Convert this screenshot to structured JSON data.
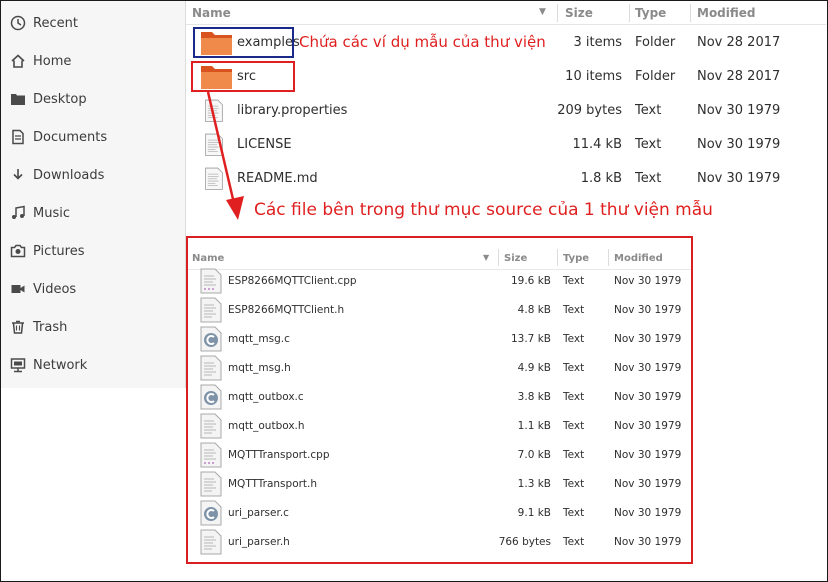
{
  "sidebar": {
    "items": [
      {
        "label": "Recent",
        "icon": "clock-icon"
      },
      {
        "label": "Home",
        "icon": "home-icon"
      },
      {
        "label": "Desktop",
        "icon": "desktop-folder-icon"
      },
      {
        "label": "Documents",
        "icon": "document-icon"
      },
      {
        "label": "Downloads",
        "icon": "download-icon"
      },
      {
        "label": "Music",
        "icon": "music-icon"
      },
      {
        "label": "Pictures",
        "icon": "camera-icon"
      },
      {
        "label": "Videos",
        "icon": "video-icon"
      },
      {
        "label": "Trash",
        "icon": "trash-icon"
      },
      {
        "label": "Network",
        "icon": "network-icon"
      }
    ]
  },
  "list": {
    "headers": {
      "name": "Name",
      "size": "Size",
      "type": "Type",
      "modified": "Modified"
    },
    "rows": [
      {
        "name": "examples",
        "size": "3 items",
        "type": "Folder",
        "modified": "Nov 28 2017",
        "icon": "folder-icon"
      },
      {
        "name": "src",
        "size": "10 items",
        "type": "Folder",
        "modified": "Nov 28 2017",
        "icon": "folder-icon"
      },
      {
        "name": "library.properties",
        "size": "209 bytes",
        "type": "Text",
        "modified": "Nov 30 1979",
        "icon": "text-file-icon"
      },
      {
        "name": "LICENSE",
        "size": "11.4 kB",
        "type": "Text",
        "modified": "Nov 30 1979",
        "icon": "text-file-icon"
      },
      {
        "name": "README.md",
        "size": "1.8 kB",
        "type": "Text",
        "modified": "Nov 30 1979",
        "icon": "text-file-icon"
      }
    ]
  },
  "annotations": {
    "examples_note": "Chứa các ví dụ mẫu của thư viện",
    "src_note": "Các file bên trong thư mục source của 1 thư viện mẫu"
  },
  "src_panel": {
    "headers": {
      "name": "Name",
      "size": "Size",
      "type": "Type",
      "modified": "Modified"
    },
    "rows": [
      {
        "name": "ESP8266MQTTClient.cpp",
        "size": "19.6 kB",
        "type": "Text",
        "modified": "Nov 30 1979",
        "icon": "cpp-file-icon"
      },
      {
        "name": "ESP8266MQTTClient.h",
        "size": "4.8 kB",
        "type": "Text",
        "modified": "Nov 30 1979",
        "icon": "header-file-icon"
      },
      {
        "name": "mqtt_msg.c",
        "size": "13.7 kB",
        "type": "Text",
        "modified": "Nov 30 1979",
        "icon": "c-file-icon"
      },
      {
        "name": "mqtt_msg.h",
        "size": "4.9 kB",
        "type": "Text",
        "modified": "Nov 30 1979",
        "icon": "header-file-icon"
      },
      {
        "name": "mqtt_outbox.c",
        "size": "3.8 kB",
        "type": "Text",
        "modified": "Nov 30 1979",
        "icon": "c-file-icon"
      },
      {
        "name": "mqtt_outbox.h",
        "size": "1.1 kB",
        "type": "Text",
        "modified": "Nov 30 1979",
        "icon": "header-file-icon"
      },
      {
        "name": "MQTTTransport.cpp",
        "size": "7.0 kB",
        "type": "Text",
        "modified": "Nov 30 1979",
        "icon": "cpp-file-icon"
      },
      {
        "name": "MQTTTransport.h",
        "size": "1.3 kB",
        "type": "Text",
        "modified": "Nov 30 1979",
        "icon": "header-file-icon"
      },
      {
        "name": "uri_parser.c",
        "size": "9.1 kB",
        "type": "Text",
        "modified": "Nov 30 1979",
        "icon": "c-file-icon"
      },
      {
        "name": "uri_parser.h",
        "size": "766 bytes",
        "type": "Text",
        "modified": "Nov 30 1979",
        "icon": "header-file-icon"
      }
    ]
  },
  "colors": {
    "annotation": "#e02020",
    "folder": "#e0662c",
    "highlight_blue": "#1a2a8a"
  }
}
